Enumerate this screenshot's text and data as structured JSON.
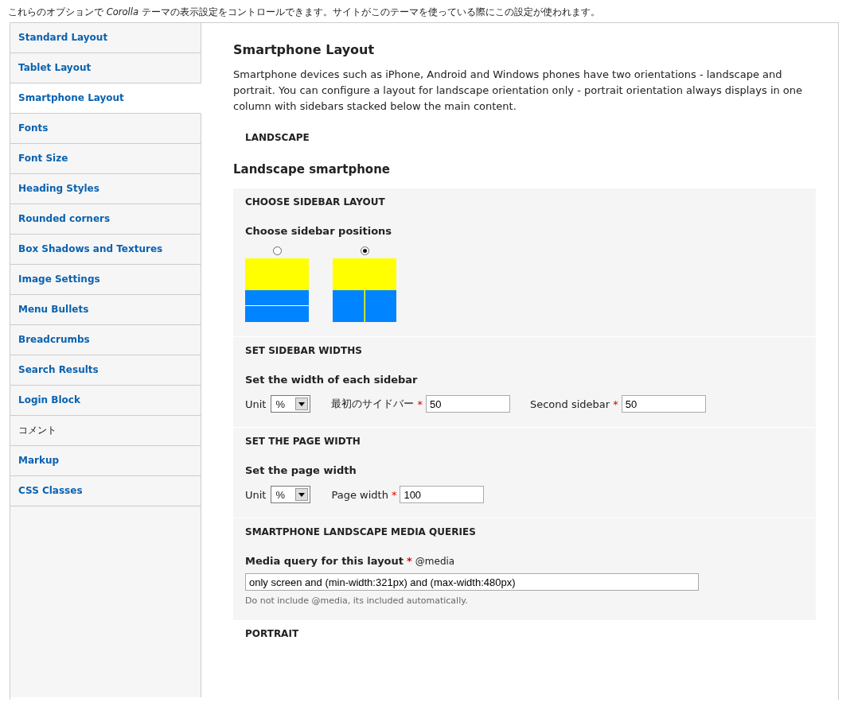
{
  "intro": "これらのオプションで *Corolla* テーマの表示設定をコントロールできます。サイトがこのテーマを使っている際にこの設定が使われます。",
  "sidebar": {
    "tabs": [
      {
        "label": "Standard Layout",
        "selected": false,
        "kind": "link"
      },
      {
        "label": "Tablet Layout",
        "selected": false,
        "kind": "link"
      },
      {
        "label": "Smartphone Layout",
        "selected": true,
        "kind": "link"
      },
      {
        "label": "Fonts",
        "selected": false,
        "kind": "link"
      },
      {
        "label": "Font Size",
        "selected": false,
        "kind": "link"
      },
      {
        "label": "Heading Styles",
        "selected": false,
        "kind": "link"
      },
      {
        "label": "Rounded corners",
        "selected": false,
        "kind": "link"
      },
      {
        "label": "Box Shadows and Textures",
        "selected": false,
        "kind": "link"
      },
      {
        "label": "Image Settings",
        "selected": false,
        "kind": "link"
      },
      {
        "label": "Menu Bullets",
        "selected": false,
        "kind": "link"
      },
      {
        "label": "Breadcrumbs",
        "selected": false,
        "kind": "link"
      },
      {
        "label": "Search Results",
        "selected": false,
        "kind": "link"
      },
      {
        "label": "Login Block",
        "selected": false,
        "kind": "link"
      },
      {
        "label": "コメント",
        "selected": false,
        "kind": "plain"
      },
      {
        "label": "Markup",
        "selected": false,
        "kind": "link"
      },
      {
        "label": "CSS Classes",
        "selected": false,
        "kind": "link"
      }
    ]
  },
  "main": {
    "title": "Smartphone Layout",
    "description": "Smartphone devices such as iPhone, Android and Windows phones have two orientations - landscape and portrait. You can configure a layout for landscape orientation only - portrait orientation always displays in one column with sidebars stacked below the main content.",
    "landscape_legend": "LANDSCAPE",
    "subheading": "Landscape smartphone",
    "fieldsets": [
      {
        "kind": "layout",
        "title": "CHOOSE SIDEBAR LAYOUT",
        "label": "Choose sidebar positions",
        "options": [
          {
            "kind": "stacked",
            "selected": false
          },
          {
            "kind": "split",
            "selected": true
          }
        ]
      },
      {
        "kind": "fields",
        "title": "SET SIDEBAR WIDTHS",
        "label": "Set the width of each sidebar",
        "unit": {
          "label": "Unit",
          "value": "%"
        },
        "fields": [
          {
            "label": "最初のサイドバー",
            "required": "*",
            "value": "50"
          },
          {
            "label": "Second sidebar",
            "required": "*",
            "value": "50"
          }
        ]
      },
      {
        "kind": "fields",
        "title": "SET THE PAGE WIDTH",
        "label": "Set the page width",
        "unit": {
          "label": "Unit",
          "value": "%"
        },
        "fields": [
          {
            "label": "Page width",
            "required": "*",
            "value": "100"
          }
        ]
      },
      {
        "kind": "media",
        "title": "SMARTPHONE LANDSCAPE MEDIA QUERIES",
        "label": "Media query for this layout",
        "required": "*",
        "suffix": "@media",
        "value": "only screen and (min-width:321px) and (max-width:480px)",
        "description": "Do not include @media, its included automatically."
      }
    ],
    "portrait_legend": "PORTRAIT"
  }
}
